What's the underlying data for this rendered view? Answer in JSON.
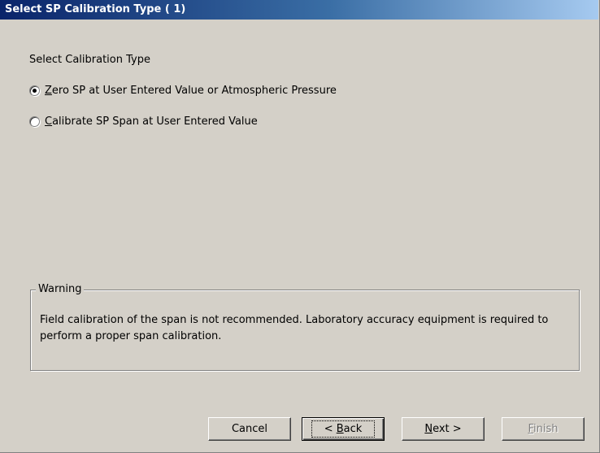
{
  "window": {
    "title": "Select SP Calibration Type ( 1)"
  },
  "main": {
    "section_label": "Select Calibration Type",
    "options": [
      {
        "mnemonic": "Z",
        "rest": "ero SP at User Entered Value or Atmospheric Pressure",
        "selected": true
      },
      {
        "mnemonic": "C",
        "rest": "alibrate SP Span at User Entered Value",
        "selected": false
      }
    ]
  },
  "warning": {
    "title": "Warning",
    "text": "Field calibration of the span is not recommended. Laboratory accuracy equipment is required to perform a proper span calibration."
  },
  "buttons": {
    "cancel": "Cancel",
    "back_prefix": "< ",
    "back_mnemonic": "B",
    "back_rest": "ack",
    "next_mnemonic": "N",
    "next_rest": "ext >",
    "finish_mnemonic": "F",
    "finish_rest": "inish"
  },
  "colors": {
    "face": "#d4d0c8",
    "title_start": "#0a246a",
    "title_end": "#a6caf0",
    "disabled_text": "#808080"
  }
}
